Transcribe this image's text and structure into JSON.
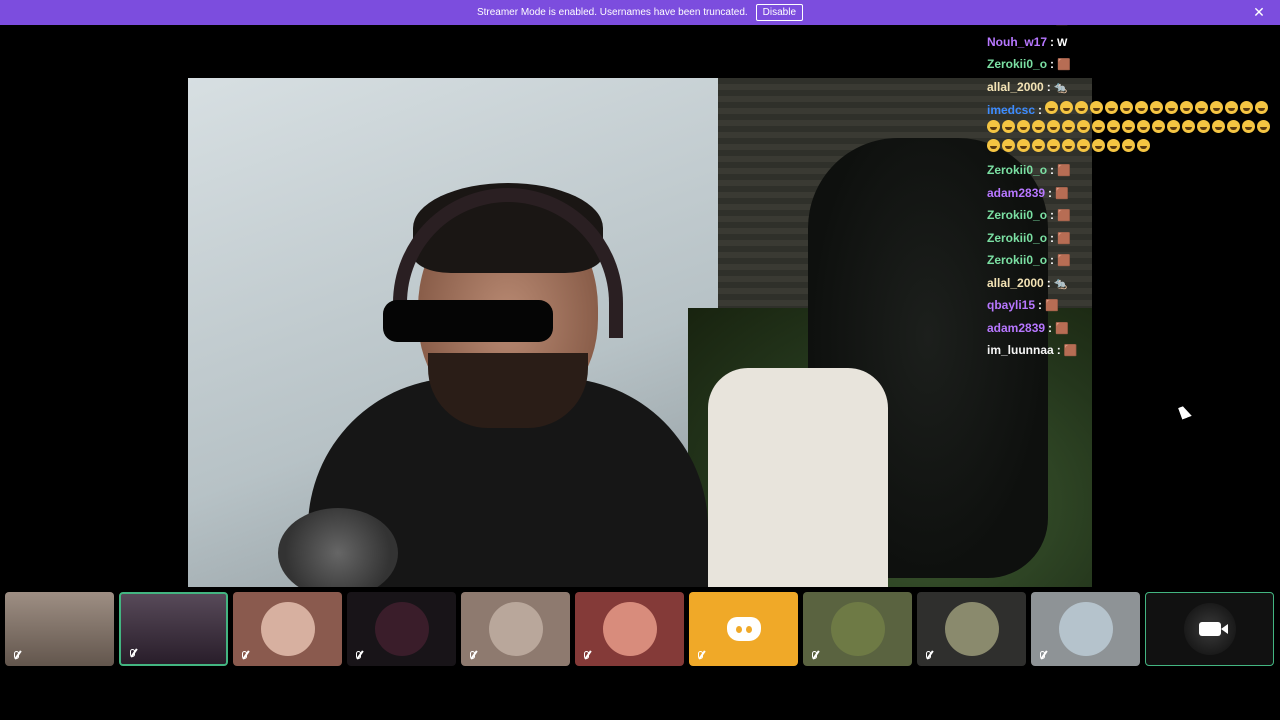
{
  "banner": {
    "message": "Streamer Mode is enabled. Usernames have been truncated.",
    "disable_label": "Disable",
    "close_glyph": "✕",
    "color": "#7c4dde"
  },
  "chat": {
    "messages": [
      {
        "user": "adam2839",
        "color": "#b777ff",
        "emote": "🟫"
      },
      {
        "user": "Nouh_w17",
        "color": "#b777ff",
        "emote": "W"
      },
      {
        "user": "Zerokii0_o",
        "color": "#7be0a3",
        "emote": "🟫"
      },
      {
        "user": "allal_2000",
        "color": "#f3e3b5",
        "emote": "🐀"
      },
      {
        "user": "imedcsc",
        "color": "#3d8cff",
        "emote": "laugh-emoji-spam"
      },
      {
        "user": "Zerokii0_o",
        "color": "#7be0a3",
        "emote": "🟫"
      },
      {
        "user": "adam2839",
        "color": "#b777ff",
        "emote": "🟫"
      },
      {
        "user": "Zerokii0_o",
        "color": "#7be0a3",
        "emote": "🟫"
      },
      {
        "user": "Zerokii0_o",
        "color": "#7be0a3",
        "emote": "🟫"
      },
      {
        "user": "Zerokii0_o",
        "color": "#7be0a3",
        "emote": "🟫"
      },
      {
        "user": "allal_2000",
        "color": "#f3e3b5",
        "emote": "🐀"
      },
      {
        "user": "qbayli15",
        "color": "#b777ff",
        "emote": "🟫"
      },
      {
        "user": "adam2839",
        "color": "#b777ff",
        "emote": "🟫"
      },
      {
        "user": "im_luunnaa",
        "color": "#f5f5f5",
        "emote": "🟫"
      }
    ],
    "separator": ":"
  },
  "tiles": [
    {
      "name": "participant-1",
      "bg": "#8d7b6e",
      "muted": true,
      "kind": "video"
    },
    {
      "name": "participant-2",
      "bg": "#3a2a3c",
      "muted": true,
      "kind": "video",
      "active": true
    },
    {
      "name": "participant-3",
      "bg": "#8a5a4e",
      "muted": true,
      "kind": "avatar",
      "avatar_bg": "#d7b0a0"
    },
    {
      "name": "participant-4",
      "bg": "#181418",
      "muted": true,
      "kind": "avatar",
      "avatar_bg": "#3a1d2a"
    },
    {
      "name": "participant-5",
      "bg": "#8e7a6f",
      "muted": true,
      "kind": "avatar",
      "avatar_bg": "#b9a79b"
    },
    {
      "name": "participant-6",
      "bg": "#843a38",
      "muted": true,
      "kind": "avatar",
      "avatar_bg": "#d88c7c"
    },
    {
      "name": "participant-7",
      "bg": "#f0a928",
      "muted": true,
      "kind": "discord"
    },
    {
      "name": "participant-8",
      "bg": "#5a6340",
      "muted": true,
      "kind": "avatar",
      "avatar_bg": "#6e7a45"
    },
    {
      "name": "participant-9",
      "bg": "#2f2f2d",
      "muted": true,
      "kind": "avatar",
      "avatar_bg": "#8a8a6d"
    },
    {
      "name": "participant-10",
      "bg": "#8e9396",
      "muted": true,
      "kind": "avatar",
      "avatar_bg": "#b5c3cc"
    }
  ],
  "camera_tile": {
    "icon": "video-camera-icon"
  }
}
